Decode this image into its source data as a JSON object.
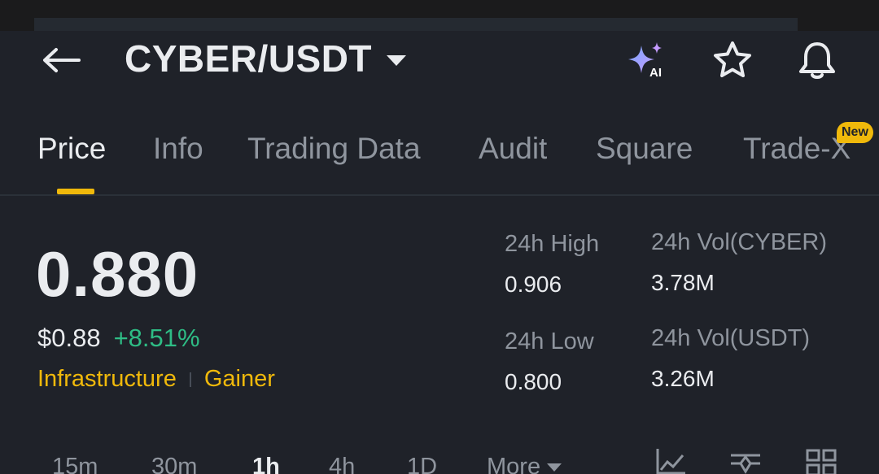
{
  "header": {
    "pair": "CYBER/USDT",
    "ai_badge": "AI",
    "icons": [
      "back-arrow-icon",
      "caret-down-icon",
      "ai-sparkle-icon",
      "star-icon",
      "bell-icon"
    ]
  },
  "tabs": [
    {
      "label": "Price",
      "active": true
    },
    {
      "label": "Info"
    },
    {
      "label": "Trading Data"
    },
    {
      "label": "Audit"
    },
    {
      "label": "Square"
    },
    {
      "label": "Trade-X",
      "badge": "New"
    }
  ],
  "price": {
    "last": "0.880",
    "usd": "$0.88",
    "change_pct": "+8.51%",
    "tags": [
      "Infrastructure",
      "Gainer"
    ]
  },
  "stats": {
    "high_label": "24h High",
    "high_value": "0.906",
    "low_label": "24h Low",
    "low_value": "0.800",
    "vol_base_label": "24h Vol(CYBER)",
    "vol_base_value": "3.78M",
    "vol_quote_label": "24h Vol(USDT)",
    "vol_quote_value": "3.26M"
  },
  "intervals": {
    "items": [
      "15m",
      "30m",
      "1h",
      "4h",
      "1D"
    ],
    "active": "1h",
    "more_label": "More"
  },
  "colors": {
    "background": "#1f2229",
    "accent": "#f0b90b",
    "positive": "#2ebd85",
    "muted": "#8f959e",
    "text": "#eaecef"
  }
}
